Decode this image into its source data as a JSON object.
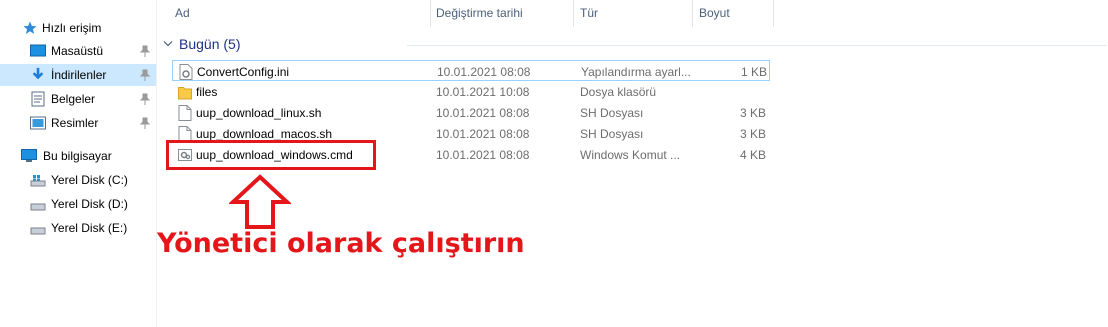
{
  "sidebar": {
    "quick_access": "Hızlı erişim",
    "items": [
      {
        "label": "Masaüstü",
        "icon": "desktop-icon",
        "pinned": true
      },
      {
        "label": "İndirilenler",
        "icon": "downloads-icon",
        "pinned": true,
        "selected": true
      },
      {
        "label": "Belgeler",
        "icon": "documents-icon",
        "pinned": true
      },
      {
        "label": "Resimler",
        "icon": "pictures-icon",
        "pinned": true
      }
    ],
    "this_pc": "Bu bilgisayar",
    "drives": [
      {
        "label": "Yerel Disk (C:)",
        "icon": "windows-drive-icon"
      },
      {
        "label": "Yerel Disk (D:)",
        "icon": "drive-icon"
      },
      {
        "label": "Yerel Disk (E:)",
        "icon": "drive-icon"
      }
    ]
  },
  "columns": {
    "name": "Ad",
    "date": "Değiştirme tarihi",
    "type": "Tür",
    "size": "Boyut"
  },
  "group": {
    "label": "Bugün (5)"
  },
  "files": [
    {
      "name": "ConvertConfig.ini",
      "date": "10.01.2021 08:08",
      "type": "Yapılandırma ayarl...",
      "size": "1 KB",
      "icon": "config-file-icon"
    },
    {
      "name": "files",
      "date": "10.01.2021 10:08",
      "type": "Dosya klasörü",
      "size": "",
      "icon": "folder-icon"
    },
    {
      "name": "uup_download_linux.sh",
      "date": "10.01.2021 08:08",
      "type": "SH Dosyası",
      "size": "3 KB",
      "icon": "file-icon"
    },
    {
      "name": "uup_download_macos.sh",
      "date": "10.01.2021 08:08",
      "type": "SH Dosyası",
      "size": "3 KB",
      "icon": "file-icon"
    },
    {
      "name": "uup_download_windows.cmd",
      "date": "10.01.2021 08:08",
      "type": "Windows Komut ...",
      "size": "4 KB",
      "icon": "cmd-file-icon"
    }
  ],
  "annotation": {
    "text": "Yönetici olarak çalıştırın",
    "color": "#e4161a"
  },
  "colors": {
    "selected_bg": "#cce8ff",
    "header_text": "#4c607a",
    "group_text": "#1e3287"
  }
}
